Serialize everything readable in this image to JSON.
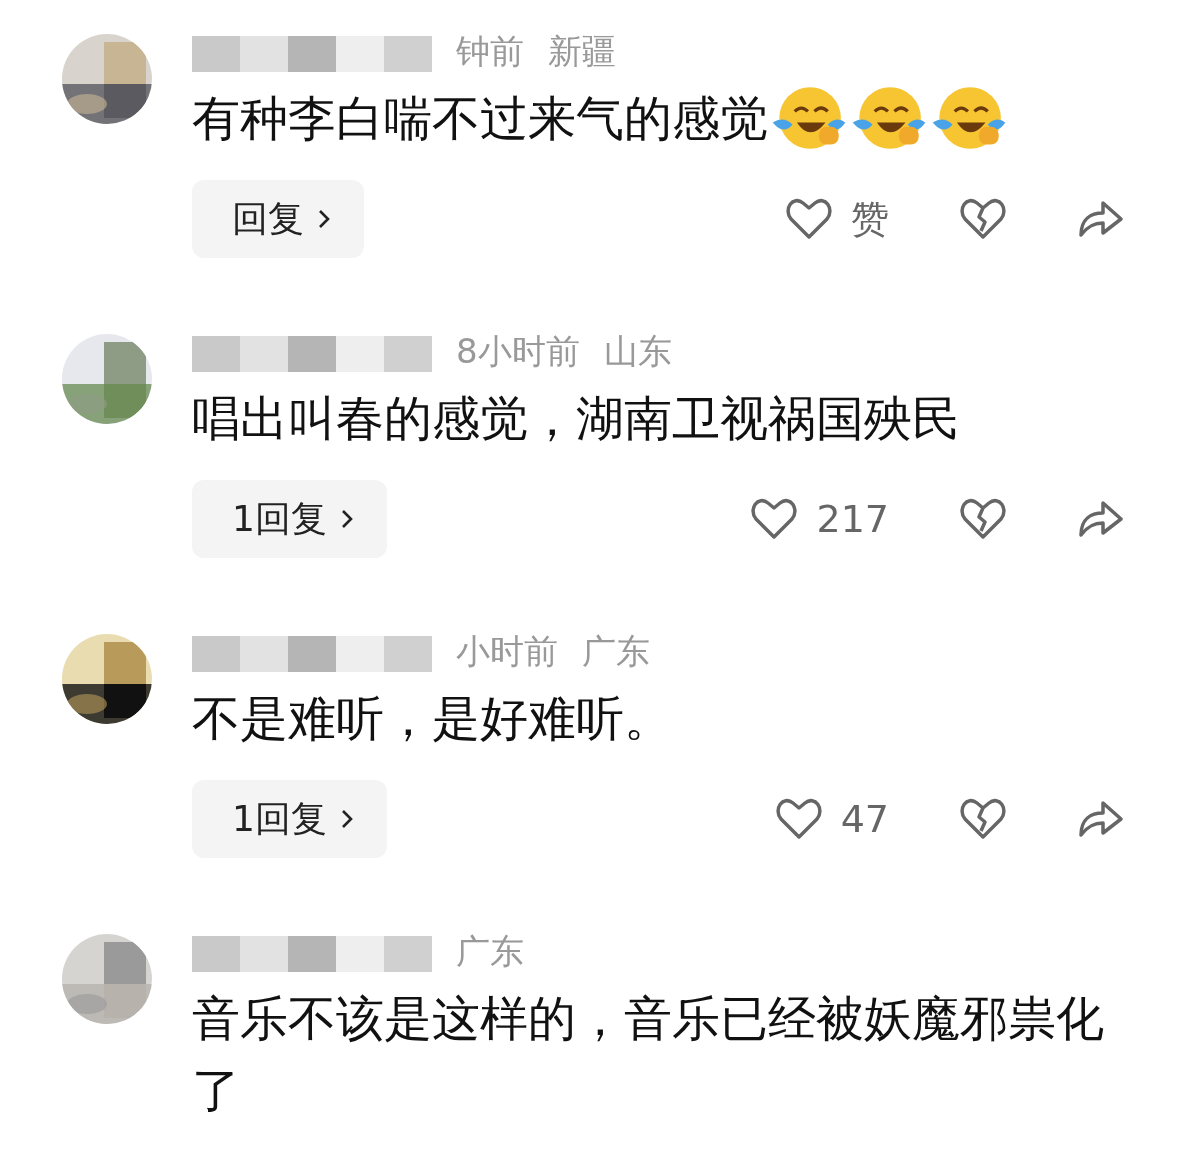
{
  "comments": [
    {
      "time": "钟前",
      "location": "新疆",
      "text": "有种李白喘不过来气的感觉",
      "emoji": true,
      "reply_label": "回复",
      "like_label": "赞"
    },
    {
      "time": "8小时前",
      "location": "山东",
      "text": "唱出叫春的感觉，湖南卫视祸国殃民",
      "emoji": false,
      "reply_label": "1回复",
      "like_label": "217"
    },
    {
      "time": "小时前",
      "location": "广东",
      "text": "不是难听，是好难听。",
      "emoji": false,
      "reply_label": "1回复",
      "like_label": "47"
    },
    {
      "location": "广东",
      "text": "音乐不该是这样的，音乐已经被妖魔邪祟化了",
      "emoji": false
    }
  ]
}
